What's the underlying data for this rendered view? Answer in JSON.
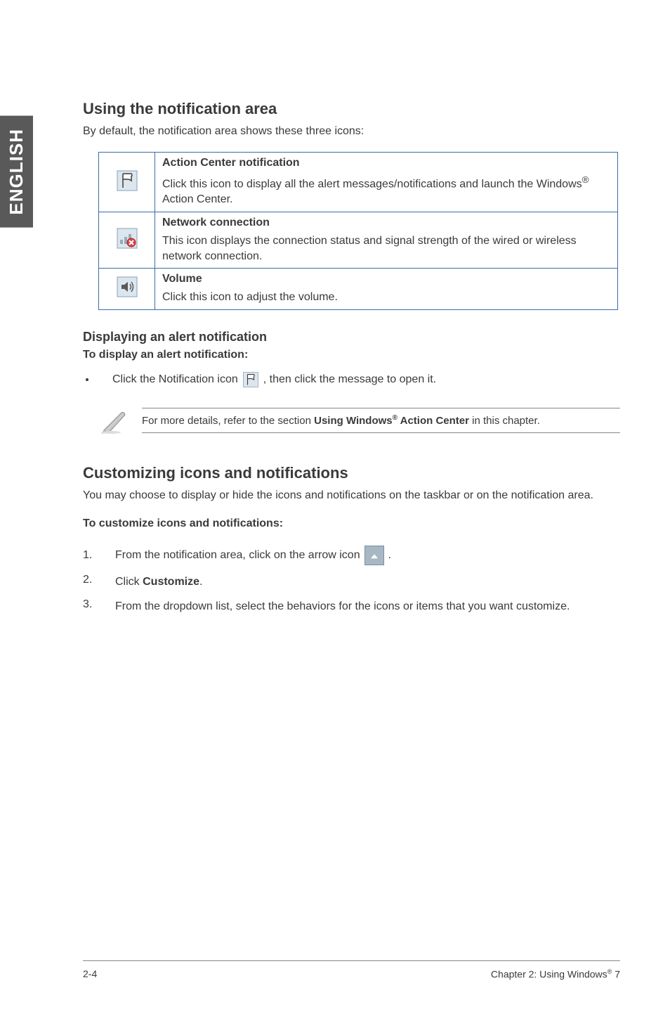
{
  "sideTab": "ENGLISH",
  "section1": {
    "heading": "Using the notification area",
    "intro": "By default, the notification area shows these three icons:"
  },
  "table": {
    "rows": [
      {
        "iconName": "flag-icon",
        "title": "Action Center notification",
        "bodyPre": "Click this icon to display all the alert messages/notifications and launch the Windows",
        "bodySup": "®",
        "bodyPost": " Action Center."
      },
      {
        "iconName": "network-icon",
        "title": "Network connection",
        "bodyPre": "This icon displays the connection status and signal strength of the wired or wireless network connection.",
        "bodySup": "",
        "bodyPost": ""
      },
      {
        "iconName": "volume-icon",
        "title": "Volume",
        "bodyPre": "Click this icon to adjust the volume.",
        "bodySup": "",
        "bodyPost": ""
      }
    ]
  },
  "subsection1": {
    "heading": "Displaying an alert notification",
    "subheading": "To display an alert notification:",
    "bulletPre": "Click the Notification icon",
    "bulletPost": ", then click the message to open it."
  },
  "note": {
    "pre": "For more details, refer to the section ",
    "bold": "Using Windows",
    "sup": "®",
    "bold2": " Action Center",
    "post": " in this chapter."
  },
  "section2": {
    "heading": "Customizing icons and notifications",
    "intro": "You may choose to display or hide the icons and notifications on the taskbar or on the notification area.",
    "subheading": "To customize icons and notifications:",
    "items": [
      {
        "num": "1.",
        "textPre": "From the notification area, click on the arrow icon",
        "hasArrow": true,
        "textPost": "."
      },
      {
        "num": "2.",
        "textPre": "Click ",
        "bold": "Customize",
        "textPost": "."
      },
      {
        "num": "3.",
        "textPre": "From the dropdown list, select the behaviors for the icons or items that you want customize."
      }
    ]
  },
  "footer": {
    "left": "2-4",
    "rightPre": "Chapter 2: Using Windows",
    "rightSup": "®",
    "rightPost": " 7"
  }
}
